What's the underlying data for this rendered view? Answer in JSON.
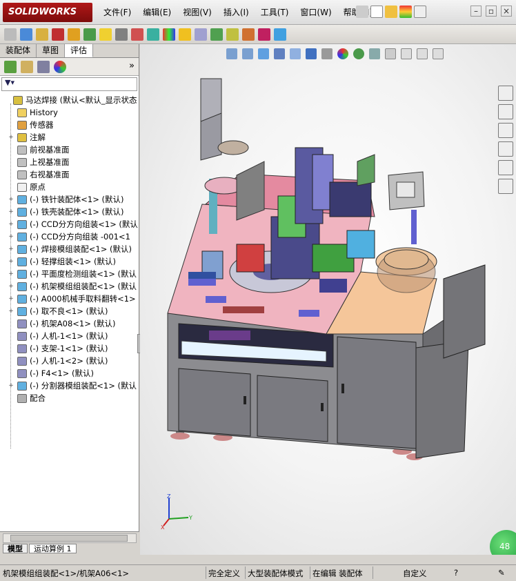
{
  "app": {
    "logo_text": "SOLIDWORKS",
    "brand_color": "#a01414"
  },
  "menu": {
    "items": [
      "文件(F)",
      "编辑(E)",
      "视图(V)",
      "插入(I)",
      "工具(T)",
      "窗口(W)",
      "帮助(H)"
    ]
  },
  "feature_manager": {
    "tabs": [
      "装配体",
      "草图",
      "评估"
    ],
    "active_tab": "评估",
    "expand_more": "»",
    "tree": [
      {
        "label": "马达焊接  (默认<默认_显示状态",
        "icon": "assembly-icon",
        "root": true
      },
      {
        "label": "History",
        "icon": "history-icon"
      },
      {
        "label": "传感器",
        "icon": "sensor-icon"
      },
      {
        "label": "注解",
        "icon": "annotation-icon",
        "expand": "+"
      },
      {
        "label": "前视基准面",
        "icon": "plane-icon"
      },
      {
        "label": "上视基准面",
        "icon": "plane-icon"
      },
      {
        "label": "右视基准面",
        "icon": "plane-icon"
      },
      {
        "label": "原点",
        "icon": "origin-icon"
      },
      {
        "label": "(-) 铁针装配体<1> (默认)",
        "icon": "subassembly-icon",
        "expand": "+"
      },
      {
        "label": "(-) 铁壳装配体<1> (默认)",
        "icon": "subassembly-icon",
        "expand": "+"
      },
      {
        "label": "(-) CCD分方向组装<1> (默认",
        "icon": "subassembly-icon",
        "expand": "+"
      },
      {
        "label": "(-) CCD分方向组装 -001<1",
        "icon": "subassembly-icon",
        "expand": "+"
      },
      {
        "label": "(-) 焊接模组装配<1> (默认)",
        "icon": "subassembly-icon",
        "expand": "+"
      },
      {
        "label": "(-) 轻撑组装<1> (默认)",
        "icon": "subassembly-icon",
        "expand": "+"
      },
      {
        "label": "(-) 平面度检测组装<1> (默认",
        "icon": "subassembly-icon",
        "expand": "+"
      },
      {
        "label": "(-) 机架模组组装配<1> (默认",
        "icon": "subassembly-icon",
        "expand": "+"
      },
      {
        "label": "(-) A000机械手取料翻转<1>",
        "icon": "subassembly-icon",
        "expand": "+"
      },
      {
        "label": "(-) 取不良<1> (默认)",
        "icon": "subassembly-icon",
        "expand": "+"
      },
      {
        "label": "(-) 机架A08<1> (默认)",
        "icon": "part-icon"
      },
      {
        "label": "(-) 人机-1<1> (默认)",
        "icon": "part-icon"
      },
      {
        "label": "(-) 支架-1<1> (默认)",
        "icon": "part-icon"
      },
      {
        "label": "(-) 人机-1<2> (默认)",
        "icon": "part-icon"
      },
      {
        "label": "(-) F4<1> (默认)",
        "icon": "part-icon"
      },
      {
        "label": "(-) 分割器模组装配<1> (默认",
        "icon": "subassembly-icon",
        "expand": "+"
      },
      {
        "label": "配合",
        "icon": "mates-icon"
      }
    ],
    "bottom_tabs": [
      "模型",
      "运动算例 1"
    ]
  },
  "viewport": {
    "triad_labels": {
      "x": "X",
      "y": "Y",
      "z": "Z"
    },
    "rt_badge": "48"
  },
  "status_bar": {
    "path": "机架模组组装配<1>/机架A06<1>",
    "fully_defined": "完全定义",
    "large_assembly": "大型装配体模式",
    "editing": "在编辑 装配体",
    "custom": "自定义"
  }
}
